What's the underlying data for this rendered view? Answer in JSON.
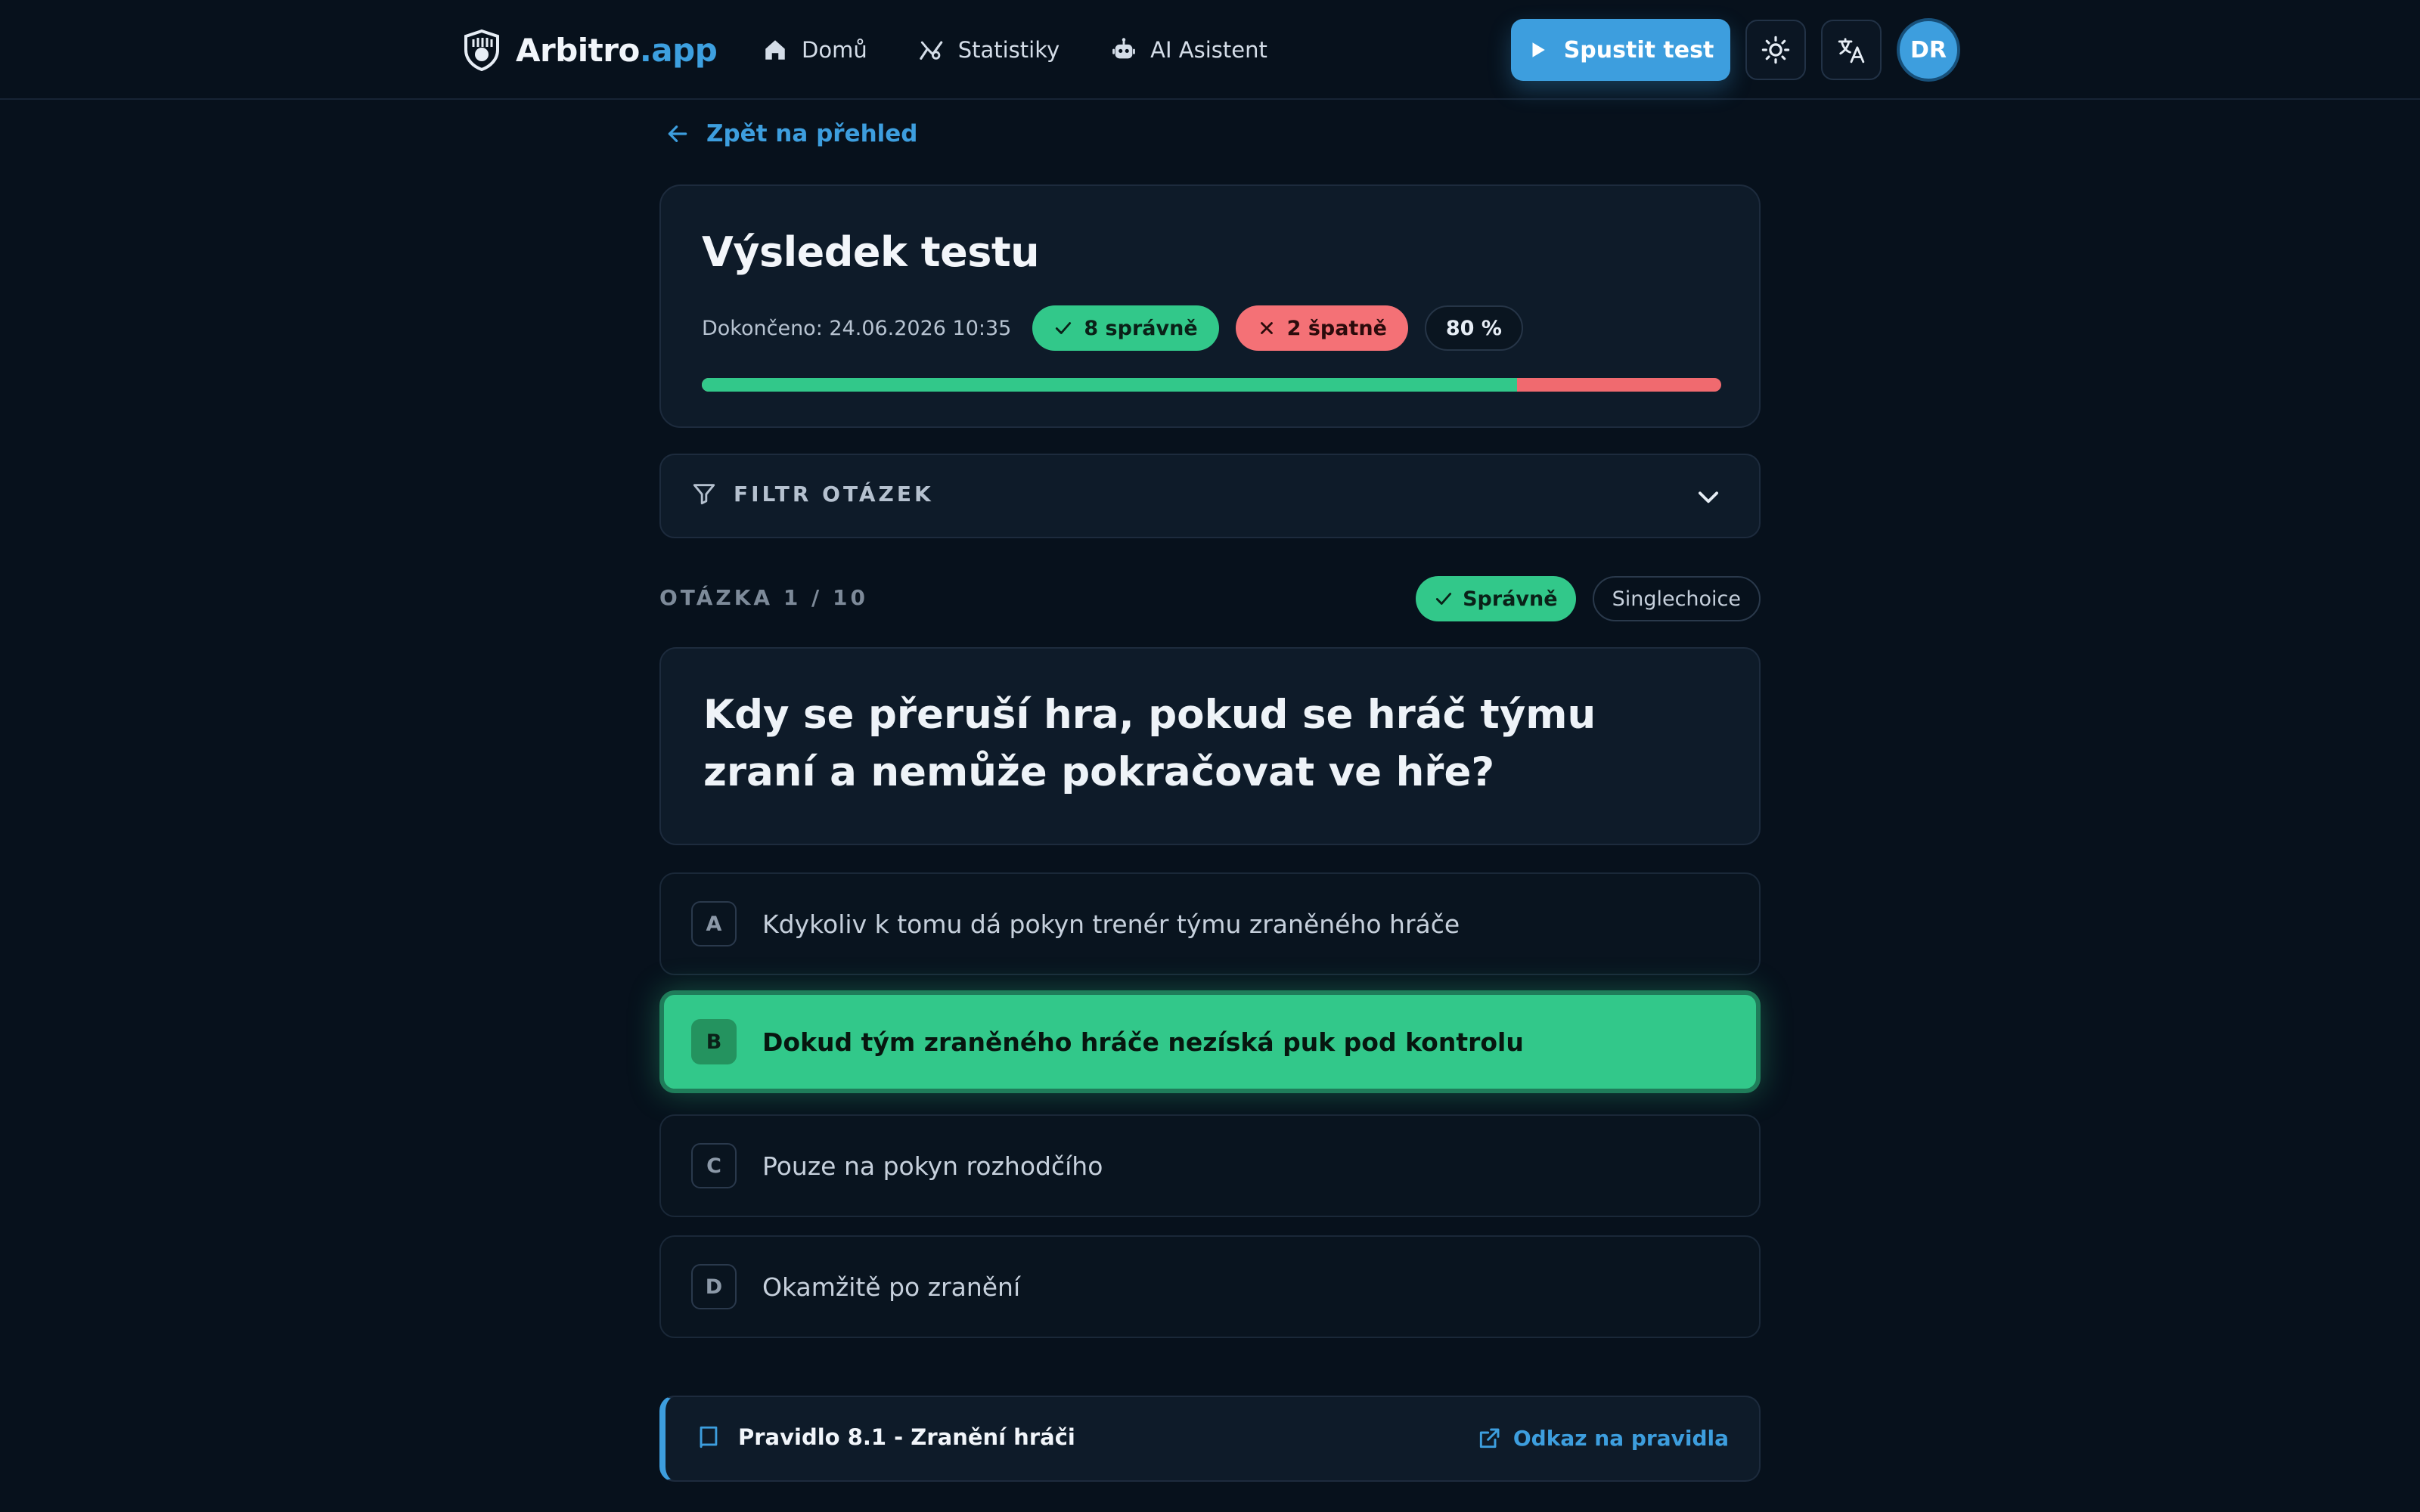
{
  "brand": {
    "name_main": "Arbitro",
    "name_accent": ".app"
  },
  "nav": [
    {
      "label": "Domů",
      "icon": "home-icon"
    },
    {
      "label": "Statistiky",
      "icon": "stats-icon"
    },
    {
      "label": "AI Asistent",
      "icon": "robot-icon"
    }
  ],
  "header": {
    "run_button": "Spustit test",
    "avatar_initials": "DR"
  },
  "back_link": "Zpět na přehled",
  "result": {
    "title": "Výsledek testu",
    "completed": "Dokončeno: 24.06.2026 10:35",
    "correct_label": "8 správně",
    "wrong_label": "2 špatně",
    "percent_label": "80 %",
    "correct_fraction": 0.8
  },
  "filter": {
    "label": "FILTR OTÁZEK"
  },
  "question": {
    "counter": "OTÁZKA 1 / 10",
    "status_tag": "Správně",
    "type_tag": "Singlechoice",
    "text": "Kdy se přeruší hra, pokud se hráč týmu zraní a nemůže pokračovat ve hře?"
  },
  "answers": [
    {
      "letter": "A",
      "text": "Kdykoliv k tomu dá pokyn trenér týmu zraněného hráče",
      "correct": false
    },
    {
      "letter": "B",
      "text": "Dokud tým zraněného hráče nezíská puk pod kontrolu",
      "correct": true
    },
    {
      "letter": "C",
      "text": "Pouze na pokyn rozhodčího",
      "correct": false
    },
    {
      "letter": "D",
      "text": "Okamžitě po zranění",
      "correct": false
    }
  ],
  "rule": {
    "title": "Pravidlo 8.1 - Zranění hráči",
    "link": "Odkaz na pravidla"
  },
  "colors": {
    "accent": "#3d9ede",
    "success": "#32c88a",
    "danger": "#f47176",
    "background": "#07111c"
  }
}
